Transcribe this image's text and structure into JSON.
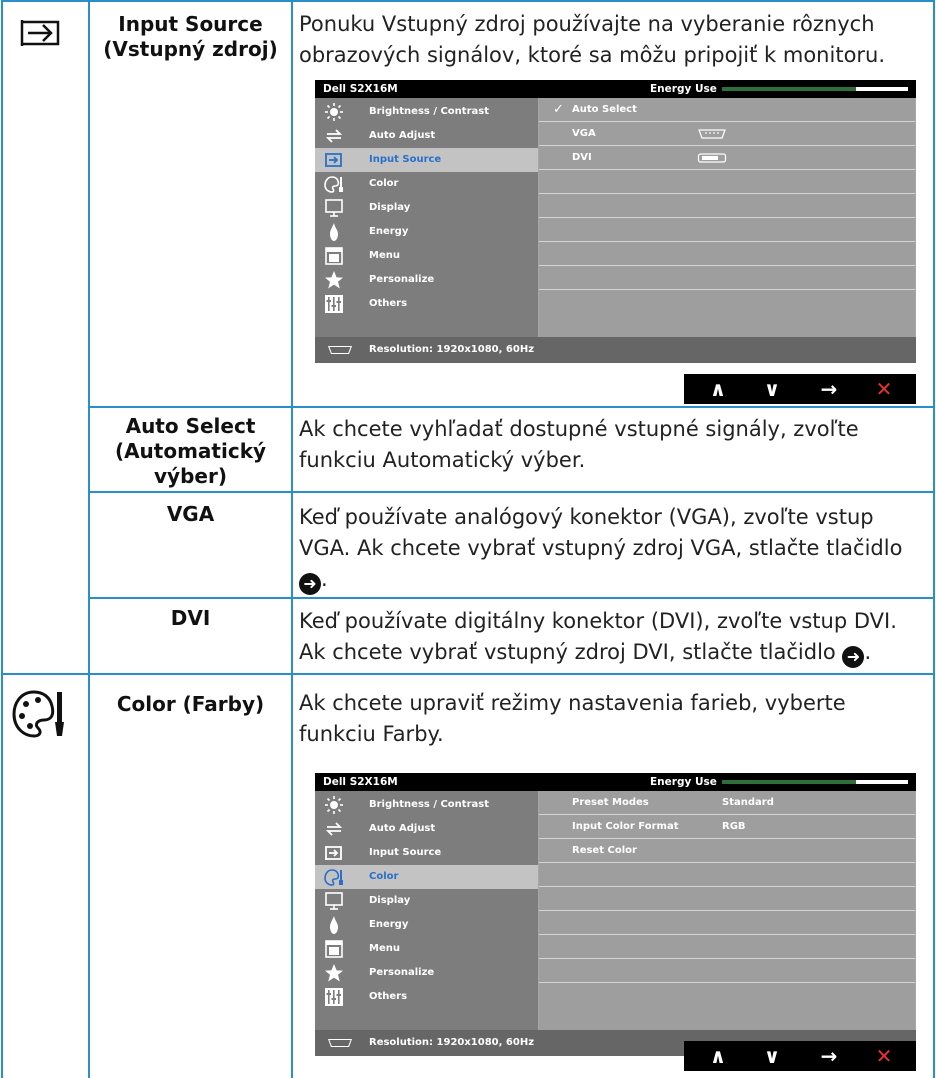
{
  "rows": [
    {
      "label": "Input Source\n(Vstupný zdroj)",
      "desc": "Ponuku Vstupný zdroj používajte na vyberanie rôznych obrazových signálov, ktoré sa môžu pripojiť k monitoru."
    },
    {
      "label": "Auto Select (Automatický výber)",
      "desc": "Ak chcete vyhľadať dostupné vstupné signály, zvoľte funkciu Automatický výber."
    },
    {
      "label": "VGA",
      "desc": "Keď používate analógový konektor (VGA), zvoľte vstup VGA. Ak chcete vybrať vstupný zdroj VGA, stlačte tlačidlo",
      "desc_end": "."
    },
    {
      "label": "DVI",
      "desc": "Keď používate digitálny konektor (DVI), zvoľte vstup DVI. Ak chcete vybrať vstupný zdroj DVI, stlačte tlačidlo",
      "desc_end": "."
    },
    {
      "label": "Color (Farby)",
      "desc": "Ak chcete upraviť režimy nastavenia farieb, vyberte funkciu Farby."
    }
  ],
  "icons": {
    "row1": "input-source-icon",
    "row5": "color-palette-icon",
    "inline": "arrow-right-circle-icon"
  },
  "osd": {
    "model": "Dell S2X16M",
    "energy_label": "Energy Use",
    "energy_level": 0.72,
    "menu": [
      {
        "label": "Brightness / Contrast",
        "icon": "brightness-icon"
      },
      {
        "label": "Auto Adjust",
        "icon": "auto-adjust-icon"
      },
      {
        "label": "Input Source",
        "icon": "input-source-icon"
      },
      {
        "label": "Color",
        "icon": "color-icon"
      },
      {
        "label": "Display",
        "icon": "display-icon"
      },
      {
        "label": "Energy",
        "icon": "energy-icon"
      },
      {
        "label": "Menu",
        "icon": "menu-icon"
      },
      {
        "label": "Personalize",
        "icon": "star-icon"
      },
      {
        "label": "Others",
        "icon": "sliders-icon"
      }
    ],
    "resolution": "Resolution: 1920x1080, 60Hz",
    "input_panel": {
      "selected_menu": 2,
      "rows": [
        {
          "label": "Auto Select",
          "value": "",
          "checked": true
        },
        {
          "label": "VGA",
          "value": "",
          "connector": "vga"
        },
        {
          "label": "DVI",
          "value": "",
          "connector": "dvi"
        }
      ]
    },
    "color_panel": {
      "selected_menu": 3,
      "rows": [
        {
          "label": "Preset Modes",
          "value": "Standard"
        },
        {
          "label": "Input Color Format",
          "value": "RGB"
        },
        {
          "label": "Reset Color",
          "value": ""
        }
      ]
    },
    "nav": {
      "up": "∧",
      "down": "∨",
      "enter": "→",
      "exit": "✕"
    }
  },
  "colors": {
    "border": "#2a8fc8",
    "selected_text": "#2a70c8",
    "exit": "#e23333"
  }
}
